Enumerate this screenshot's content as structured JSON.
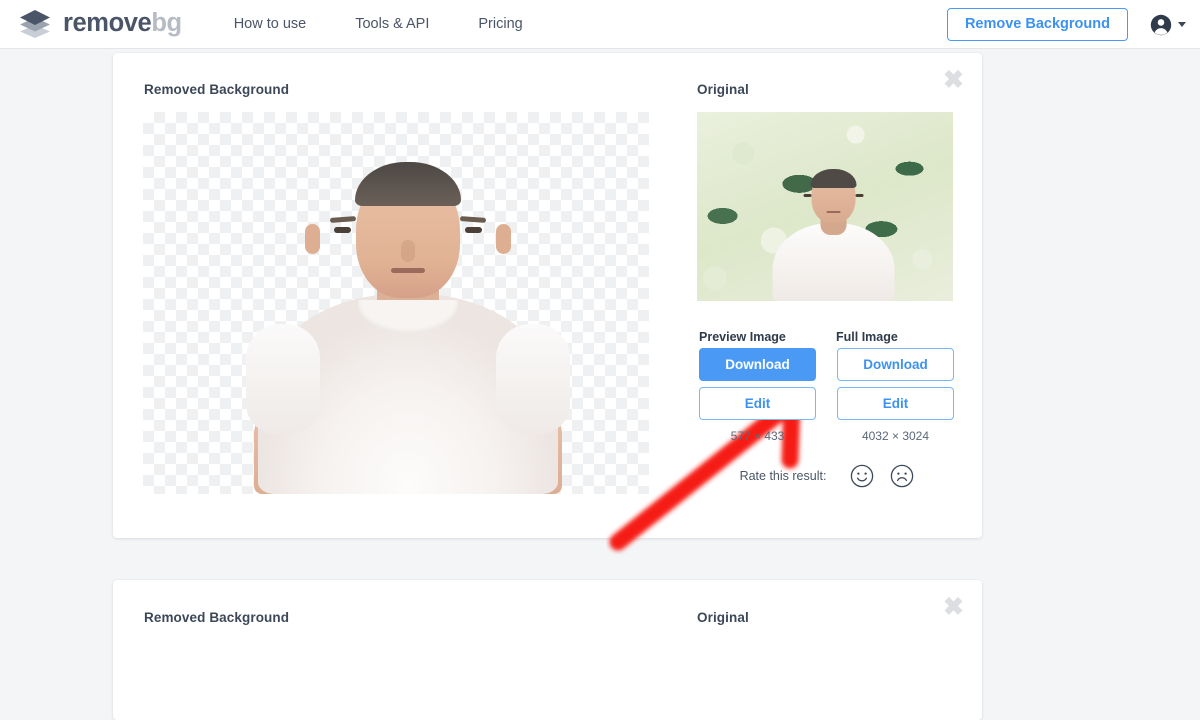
{
  "header": {
    "brand": {
      "word1": "remove",
      "word2": "bg",
      "logo_icon": "layers-diamond-icon"
    },
    "nav": [
      {
        "label": "How to use"
      },
      {
        "label": "Tools & API"
      },
      {
        "label": "Pricing"
      }
    ],
    "remove_background_button": "Remove Background",
    "account_icon": "account-circle-icon",
    "account_caret_icon": "chevron-down-icon"
  },
  "card1": {
    "close_icon": "close-icon",
    "close_glyph": "✖",
    "removed_title": "Removed Background",
    "original_title": "Original",
    "preview_label": "Preview Image",
    "full_label": "Full Image",
    "preview_download": "Download",
    "preview_edit": "Edit",
    "full_download": "Download",
    "full_edit": "Edit",
    "preview_dimensions": "577 × 433",
    "full_dimensions": "4032 × 3024",
    "rate_label": "Rate this result:",
    "rate_happy_icon": "smiley-face-icon",
    "rate_sad_icon": "frowny-face-icon",
    "annotation_icon": "red-arrow-annotation"
  },
  "card2": {
    "close_icon": "close-icon",
    "close_glyph": "✖",
    "removed_title": "Removed Background",
    "original_title": "Original"
  },
  "colors": {
    "accent_blue": "#4a9af5",
    "accent_blue_text": "#3d92f0",
    "page_background": "#f4f5f7",
    "card_background": "#ffffff",
    "text_dark": "#3c4858",
    "brand_gray": "#b7bcc4",
    "annotation_red": "#f61b13"
  }
}
